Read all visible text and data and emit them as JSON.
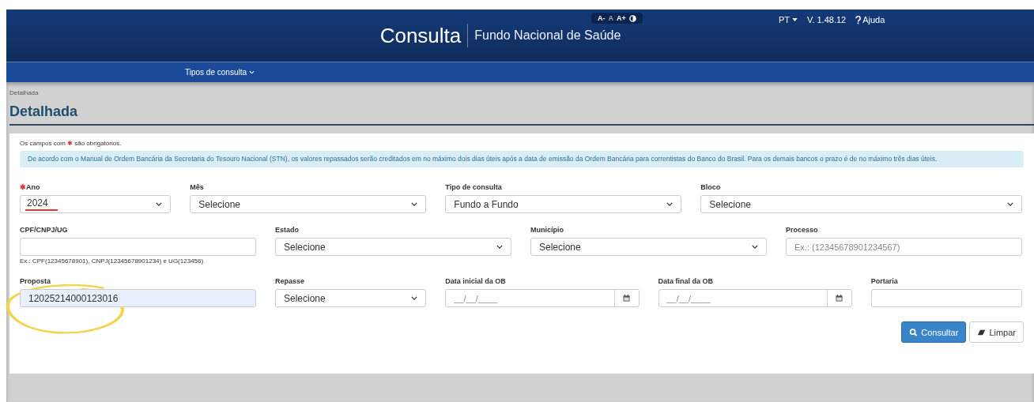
{
  "header": {
    "title": "Consulta",
    "subtitle": "Fundo Nacional de Saúde",
    "font_controls": [
      "A-",
      "A",
      "A+"
    ],
    "language": "PT",
    "version": "V. 1.48.12",
    "help": "Ajuda"
  },
  "nav": {
    "items": [
      "Tipos de consulta"
    ]
  },
  "breadcrumb": "Detalhada",
  "page_title": "Detalhada",
  "required_mark": "✱",
  "required_note": {
    "before": "Os campos com",
    "after": "são obrigatórios."
  },
  "info": "De acordo com o Manual de Ordem Bancária da Secretaria do Tesouro Nacional (STN), os valores repassados serão creditados em no máximo dois dias úteis após a data de emissão da Ordem Bancária para correntistas do Banco do Brasil. Para os demais bancos o prazo é de no máximo três dias úteis.",
  "rows": [
    {
      "fields": [
        {
          "label": "Ano",
          "kind": "select",
          "value": "2024",
          "required": true,
          "underlined": true
        },
        {
          "label": "Mês",
          "kind": "select",
          "value": "Selecione",
          "required": false
        },
        {
          "label": "Tipo de consulta",
          "kind": "select",
          "value": "Fundo a Fundo",
          "required": false
        },
        {
          "label": "Bloco",
          "kind": "select",
          "value": "Selecione",
          "required": false
        }
      ]
    },
    {
      "fields": [
        {
          "label": "CPF/CNPJ/UG",
          "kind": "input",
          "help": "Ex.: CPF(12345678901), CNPJ(12345678901234) e UG(123456)",
          "required": false
        },
        {
          "label": "Estado",
          "kind": "select",
          "value": "Selecione",
          "required": false
        },
        {
          "label": "Município",
          "kind": "select",
          "value": "Selecione",
          "required": false
        },
        {
          "label": "Processo",
          "kind": "input",
          "placeholder": "Ex.: (12345678901234567)",
          "required": false
        }
      ]
    },
    {
      "fields": [
        {
          "label": "Proposta",
          "kind": "input",
          "value": "12025214000123016",
          "autofilled": true,
          "circled": true,
          "required": false
        },
        {
          "label": "Repasse",
          "kind": "select",
          "value": "Selecione",
          "required": false
        },
        {
          "label": "Data inicial da OB",
          "kind": "date",
          "placeholder": "__/__/____",
          "required": false
        },
        {
          "label": "Data final da OB",
          "kind": "date",
          "placeholder": "__/__/____",
          "required": false
        },
        {
          "label": "Portaria",
          "kind": "input",
          "required": false
        }
      ]
    }
  ],
  "buttons": [
    {
      "label": "Consultar",
      "kind": "primary"
    },
    {
      "label": "Limpar",
      "kind": "default"
    }
  ]
}
